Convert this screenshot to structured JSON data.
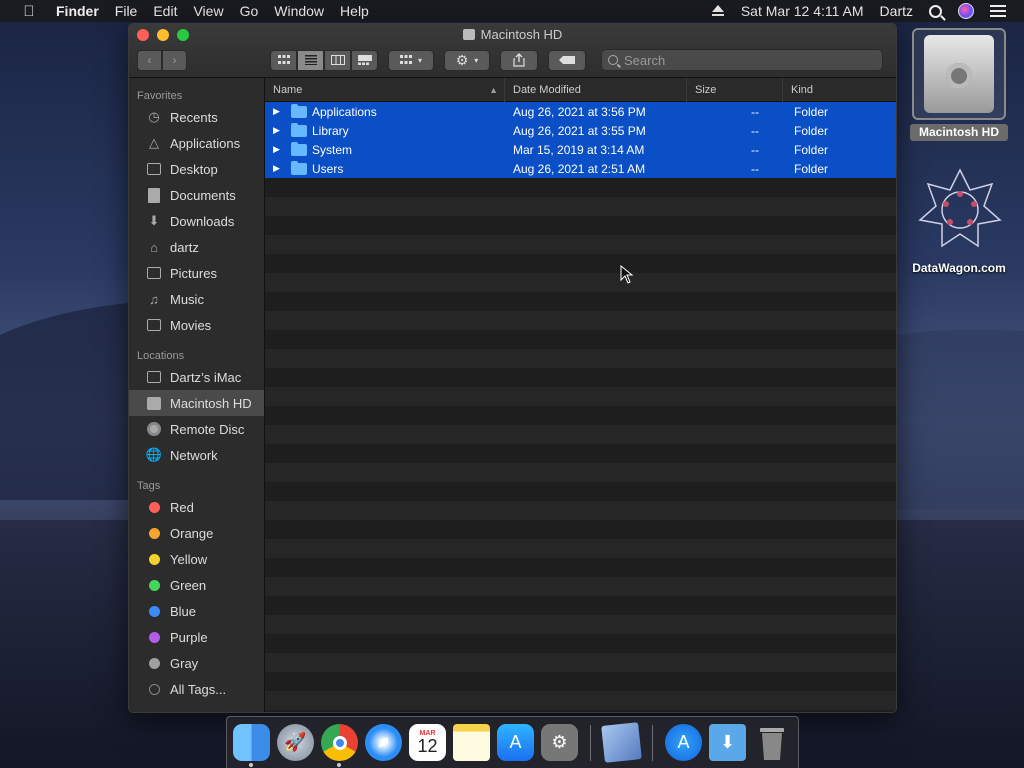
{
  "menubar": {
    "app_name": "Finder",
    "menus": [
      "File",
      "Edit",
      "View",
      "Go",
      "Window",
      "Help"
    ],
    "clock": "Sat Mar 12  4:11 AM",
    "user": "Dartz"
  },
  "window": {
    "title": "Macintosh HD",
    "search_placeholder": "Search"
  },
  "sidebar": {
    "favorites_header": "Favorites",
    "favorites": [
      "Recents",
      "Applications",
      "Desktop",
      "Documents",
      "Downloads",
      "dartz",
      "Pictures",
      "Music",
      "Movies"
    ],
    "locations_header": "Locations",
    "locations": [
      "Dartz’s iMac",
      "Macintosh HD",
      "Remote Disc",
      "Network"
    ],
    "selected_location": "Macintosh HD",
    "tags_header": "Tags",
    "tags": [
      {
        "label": "Red",
        "color": "#ff5f57"
      },
      {
        "label": "Orange",
        "color": "#f7a431"
      },
      {
        "label": "Yellow",
        "color": "#f5d22b"
      },
      {
        "label": "Green",
        "color": "#42d65a"
      },
      {
        "label": "Blue",
        "color": "#3a8cf7"
      },
      {
        "label": "Purple",
        "color": "#b35ce6"
      },
      {
        "label": "Gray",
        "color": "#a0a0a0"
      },
      {
        "label": "All Tags...",
        "color": ""
      }
    ]
  },
  "columns": {
    "name": "Name",
    "date": "Date Modified",
    "size": "Size",
    "kind": "Kind"
  },
  "files": [
    {
      "name": "Applications",
      "date": "Aug 26, 2021 at 3:56 PM",
      "size": "--",
      "kind": "Folder",
      "selected": true
    },
    {
      "name": "Library",
      "date": "Aug 26, 2021 at 3:55 PM",
      "size": "--",
      "kind": "Folder",
      "selected": true
    },
    {
      "name": "System",
      "date": "Mar 15, 2019 at 3:14 AM",
      "size": "--",
      "kind": "Folder",
      "selected": true
    },
    {
      "name": "Users",
      "date": "Aug 26, 2021 at 2:51 AM",
      "size": "--",
      "kind": "Folder",
      "selected": true
    }
  ],
  "desktop": {
    "hd_label": "Macintosh HD",
    "dw_label": "DataWagon.com"
  },
  "dock": {
    "calendar_month": "MAR",
    "calendar_day": "12",
    "icons": [
      "finder-icon",
      "launchpad-icon",
      "chrome-icon",
      "safari-icon",
      "calendar-icon",
      "notes-icon",
      "app-store-icon",
      "system-preferences-icon",
      "preview-icon",
      "applications-stack-icon",
      "downloads-stack-icon",
      "trash-icon"
    ]
  },
  "colors": {
    "selection": "#0a4fc6",
    "folder": "#66b8ff",
    "sidebar_bg": "#2c2c2c",
    "window_bg": "#1e1e1e"
  }
}
